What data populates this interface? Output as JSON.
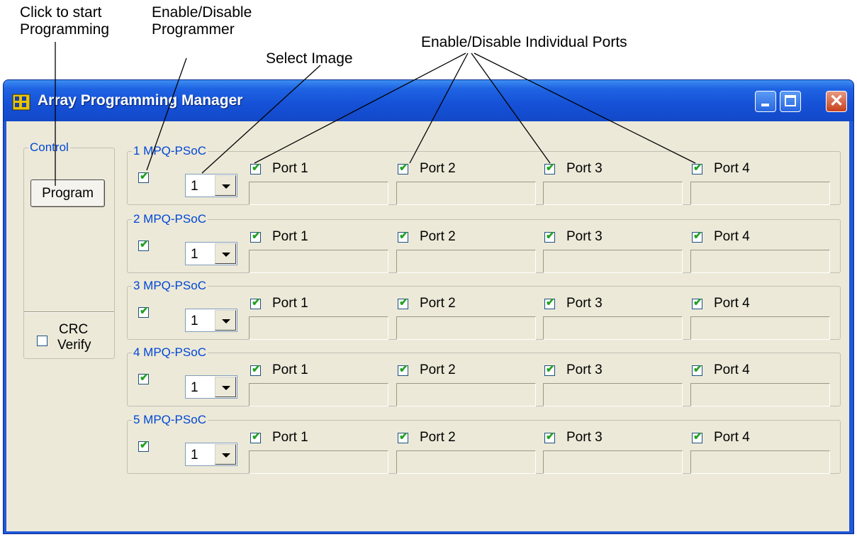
{
  "callouts": {
    "start_programming": "Click to start\nProgramming",
    "enable_programmer": "Enable/Disable\nProgrammer",
    "select_image": "Select Image",
    "enable_ports": "Enable/Disable Individual Ports"
  },
  "window": {
    "title": "Array Programming Manager",
    "icon": "app-grid-icon",
    "controls": [
      "minimize-icon",
      "maximize-icon",
      "close-icon"
    ]
  },
  "control": {
    "legend": "Control",
    "program_label": "Program",
    "crc_label_line1": "CRC",
    "crc_label_line2": "Verify",
    "crc_checked": false
  },
  "programmers": [
    {
      "name": "1 MPQ-PSoC",
      "enabled": true,
      "image": "1",
      "ports": [
        {
          "label": "Port 1",
          "checked": true
        },
        {
          "label": "Port 2",
          "checked": true
        },
        {
          "label": "Port 3",
          "checked": true
        },
        {
          "label": "Port 4",
          "checked": true
        }
      ]
    },
    {
      "name": "2 MPQ-PSoC",
      "enabled": true,
      "image": "1",
      "ports": [
        {
          "label": "Port 1",
          "checked": true
        },
        {
          "label": "Port 2",
          "checked": true
        },
        {
          "label": "Port 3",
          "checked": true
        },
        {
          "label": "Port 4",
          "checked": true
        }
      ]
    },
    {
      "name": "3 MPQ-PSoC",
      "enabled": true,
      "image": "1",
      "ports": [
        {
          "label": "Port 1",
          "checked": true
        },
        {
          "label": "Port 2",
          "checked": true
        },
        {
          "label": "Port 3",
          "checked": true
        },
        {
          "label": "Port 4",
          "checked": true
        }
      ]
    },
    {
      "name": "4 MPQ-PSoC",
      "enabled": true,
      "image": "1",
      "ports": [
        {
          "label": "Port 1",
          "checked": true
        },
        {
          "label": "Port 2",
          "checked": true
        },
        {
          "label": "Port 3",
          "checked": true
        },
        {
          "label": "Port 4",
          "checked": true
        }
      ]
    },
    {
      "name": "5 MPQ-PSoC",
      "enabled": true,
      "image": "1",
      "ports": [
        {
          "label": "Port 1",
          "checked": true
        },
        {
          "label": "Port 2",
          "checked": true
        },
        {
          "label": "Port 3",
          "checked": true
        },
        {
          "label": "Port 4",
          "checked": true
        }
      ]
    }
  ],
  "colors": {
    "titlebar": "#1f58d9",
    "client": "#ece9d8",
    "legend_text": "#0046d5",
    "check": "#21a121"
  }
}
